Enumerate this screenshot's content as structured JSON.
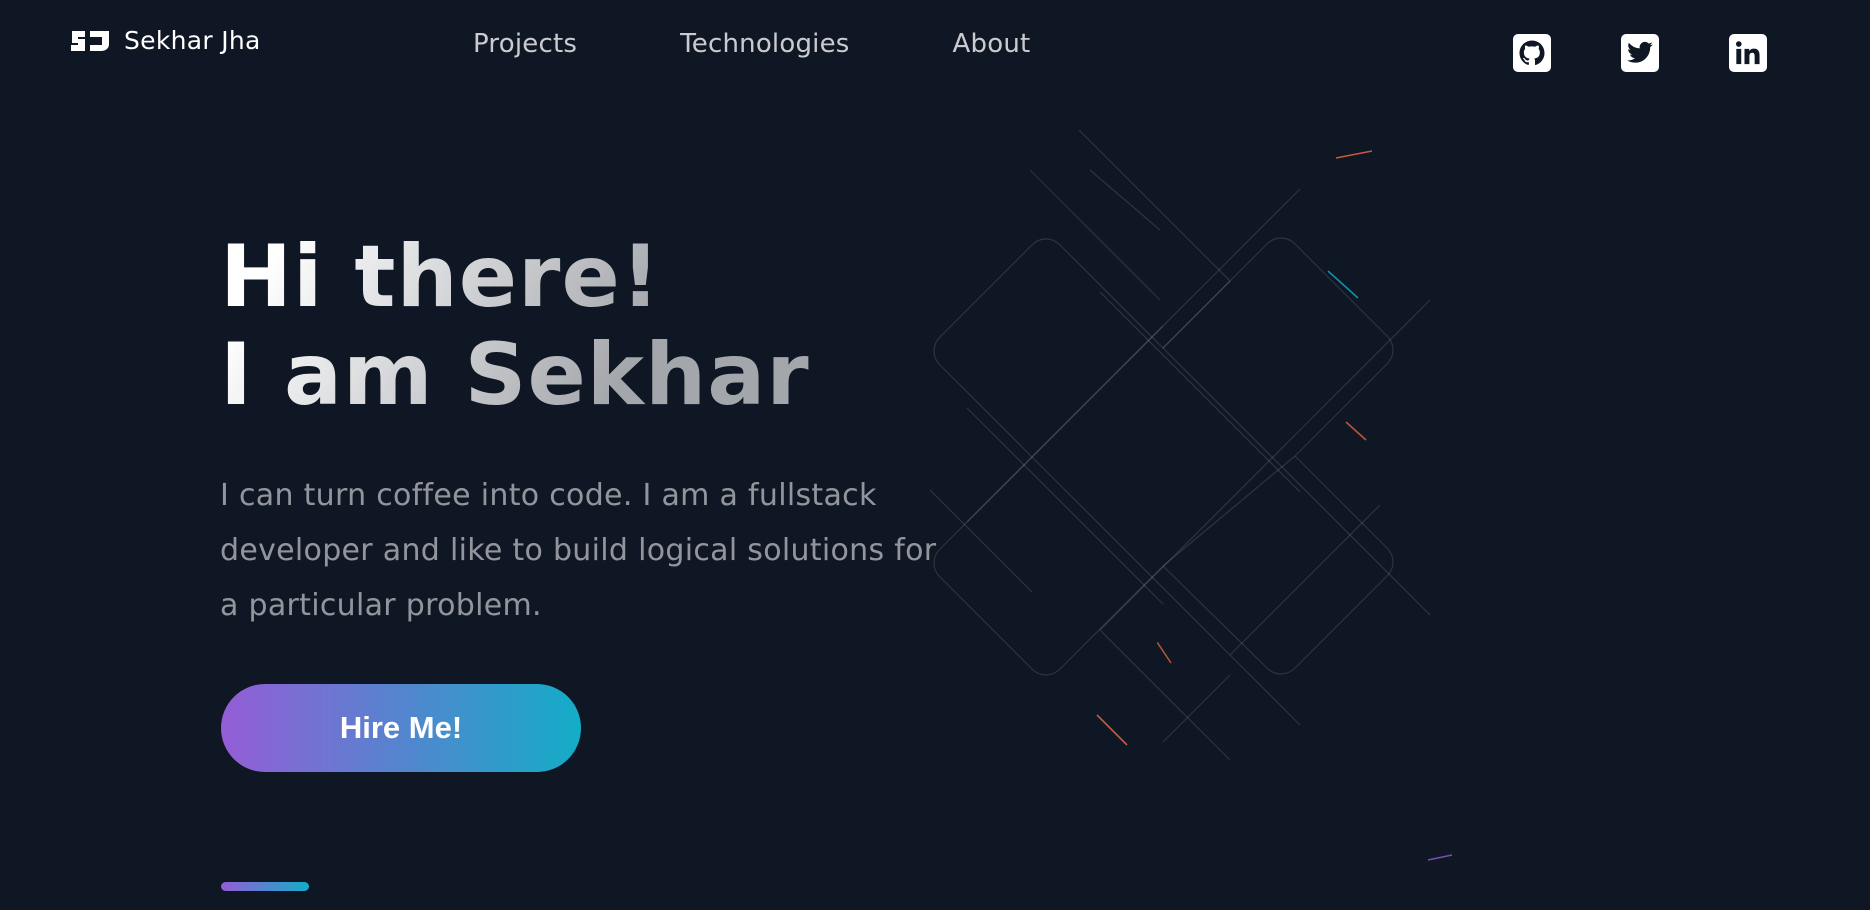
{
  "header": {
    "brand_name": "Sekhar Jha",
    "logo_text": "SJ",
    "nav": [
      {
        "label": "Projects"
      },
      {
        "label": "Technologies"
      },
      {
        "label": "About"
      }
    ],
    "socials": [
      {
        "icon": "github-icon"
      },
      {
        "icon": "twitter-icon"
      },
      {
        "icon": "linkedin-icon"
      }
    ]
  },
  "hero": {
    "title_line1": "Hi there!",
    "title_line2": "I am Sekhar",
    "description": "I can turn coffee into code. I am a fullstack developer and like to build logical solutions for a particular problem.",
    "cta_label": "Hire Me!"
  },
  "colors": {
    "background": "#0f1624",
    "gradient_start": "#945dd6",
    "gradient_mid": "#6978d1",
    "gradient_end": "#13adc7",
    "accent_orange": "#e4673e"
  }
}
